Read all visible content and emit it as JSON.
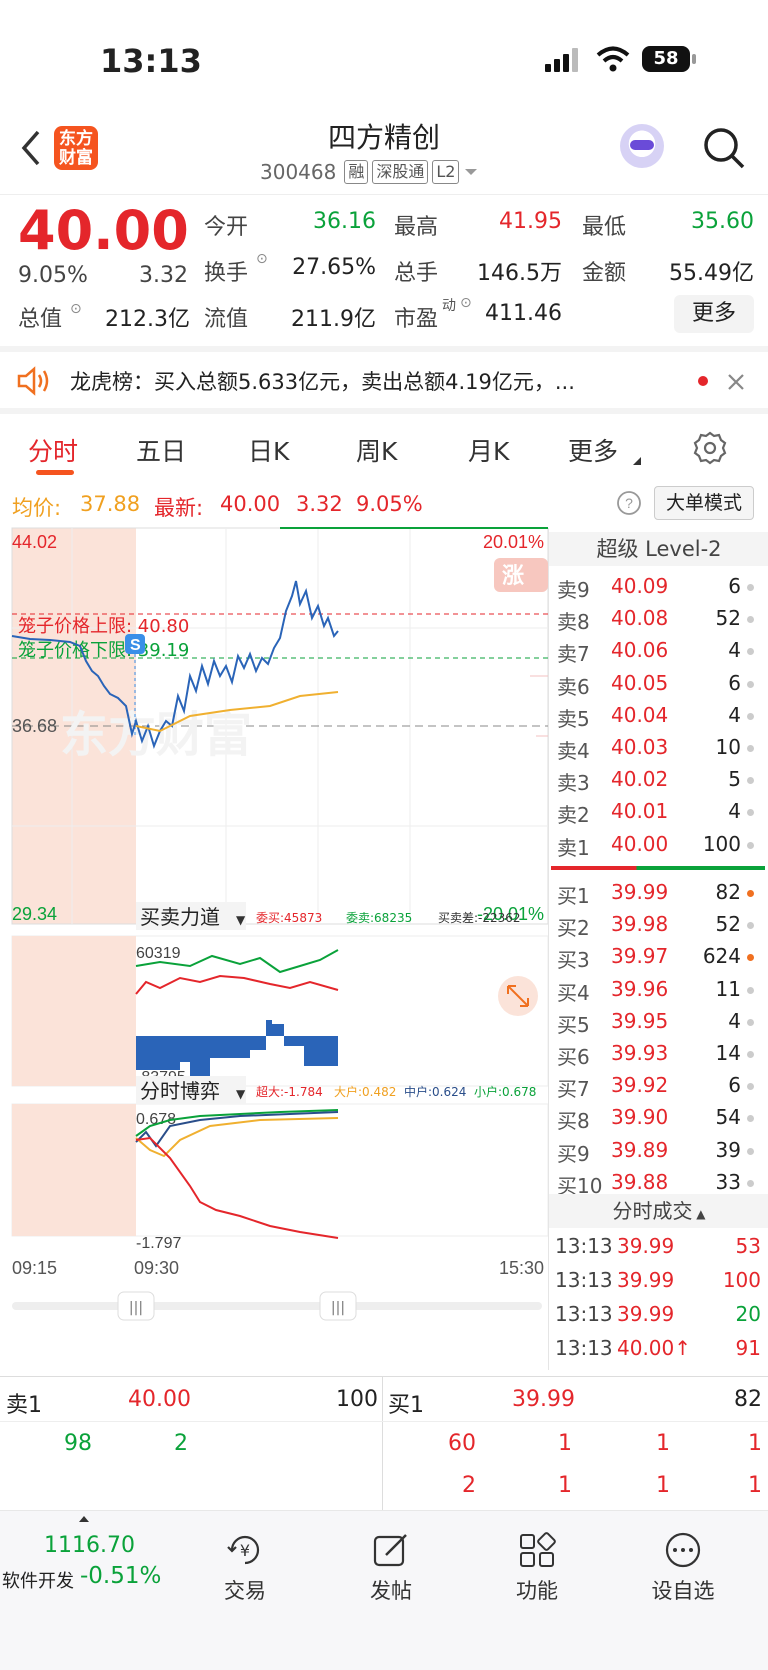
{
  "status_bar": {
    "time": "13:13",
    "battery": "58"
  },
  "header": {
    "logo_line1": "东方",
    "logo_line2": "财富",
    "title": "四方精创",
    "code": "300468",
    "tags": [
      "融",
      "深股通",
      "L2"
    ]
  },
  "quote": {
    "price": "40.00",
    "change_pct": "9.05%",
    "change": "3.32",
    "stats": [
      {
        "label": "今开",
        "value": "36.16",
        "color": "green"
      },
      {
        "label": "最高",
        "value": "41.95",
        "color": "red"
      },
      {
        "label": "最低",
        "value": "35.60",
        "color": "green"
      },
      {
        "label": "换手",
        "value": "27.65%",
        "color": "dark"
      },
      {
        "label": "总手",
        "value": "146.5万",
        "color": "dark"
      },
      {
        "label": "金额",
        "value": "55.49亿",
        "color": "dark"
      },
      {
        "label": "总值",
        "value": "212.3亿",
        "color": "dark"
      },
      {
        "label": "流值",
        "value": "211.9亿",
        "color": "dark"
      },
      {
        "label": "市盈",
        "value": "411.46",
        "color": "dark"
      }
    ],
    "pe_sup": "动",
    "more_label": "更多"
  },
  "banner": {
    "text": "龙虎榜：买入总额5.633亿元，卖出总额4.19亿元，..."
  },
  "tabs": [
    "分时",
    "五日",
    "日K",
    "周K",
    "月K",
    "更多"
  ],
  "info_line": {
    "avg_label": "均价:",
    "avg_value": "37.88",
    "latest_label": "最新:",
    "latest_value": "40.00",
    "latest_change": "3.32",
    "latest_pct": "9.05%",
    "mode_button": "大单模式"
  },
  "chart_data": {
    "type": "line",
    "y_max_label": "44.02",
    "y_min_label": "29.34",
    "y_mid_label": "36.68",
    "pct_max_label": "20.01%",
    "pct_min_label": "-20.01%",
    "cage_upper": "笼子价格上限: 40.80",
    "cage_lower": "笼子价格下限: 39.19",
    "ylim": [
      29.34,
      44.02
    ],
    "time_labels": [
      "09:15",
      "09:30",
      "15:30"
    ],
    "watermark": "东方财富",
    "limit_badge": "涨",
    "s_marker": "S",
    "sub1_title": "买卖力道",
    "sub1_stats": [
      "委买:45873",
      "委卖:68235",
      "买卖差:-22362"
    ],
    "sub1_max": "60319",
    "sub1_min": "-83795",
    "sub2_title": "分时博弈",
    "sub2_stats": [
      "超大:-1.784",
      "大户:0.482",
      "中户:0.624",
      "小户:0.678"
    ],
    "sub2_max": "0.678",
    "sub2_min": "-1.797"
  },
  "order_book": {
    "title": "超级 Level-2",
    "asks": [
      {
        "label": "卖9",
        "price": "40.09",
        "vol": "6"
      },
      {
        "label": "卖8",
        "price": "40.08",
        "vol": "52"
      },
      {
        "label": "卖7",
        "price": "40.06",
        "vol": "4"
      },
      {
        "label": "卖6",
        "price": "40.05",
        "vol": "6"
      },
      {
        "label": "卖5",
        "price": "40.04",
        "vol": "4"
      },
      {
        "label": "卖4",
        "price": "40.03",
        "vol": "10"
      },
      {
        "label": "卖3",
        "price": "40.02",
        "vol": "5"
      },
      {
        "label": "卖2",
        "price": "40.01",
        "vol": "4"
      },
      {
        "label": "卖1",
        "price": "40.00",
        "vol": "100"
      }
    ],
    "bids": [
      {
        "label": "买1",
        "price": "39.99",
        "vol": "82"
      },
      {
        "label": "买2",
        "price": "39.98",
        "vol": "52"
      },
      {
        "label": "买3",
        "price": "39.97",
        "vol": "624"
      },
      {
        "label": "买4",
        "price": "39.96",
        "vol": "11"
      },
      {
        "label": "买5",
        "price": "39.95",
        "vol": "4"
      },
      {
        "label": "买6",
        "price": "39.93",
        "vol": "14"
      },
      {
        "label": "买7",
        "price": "39.92",
        "vol": "6"
      },
      {
        "label": "买8",
        "price": "39.90",
        "vol": "54"
      },
      {
        "label": "买9",
        "price": "39.89",
        "vol": "39"
      },
      {
        "label": "买10",
        "price": "39.88",
        "vol": "33"
      }
    ],
    "trades_title": "分时成交",
    "trades": [
      {
        "time": "13:13",
        "price": "39.99",
        "vol": "53",
        "color": "red"
      },
      {
        "time": "13:13",
        "price": "39.99",
        "vol": "100",
        "color": "red"
      },
      {
        "time": "13:13",
        "price": "39.99",
        "vol": "20",
        "color": "green"
      },
      {
        "time": "13:13",
        "price": "40.00↑",
        "vol": "91",
        "color": "red"
      }
    ]
  },
  "summary": {
    "ask_label": "卖1",
    "ask_price": "40.00",
    "ask_vol": "100",
    "bid_label": "买1",
    "bid_price": "39.99",
    "bid_vol": "82",
    "left_row": [
      "98",
      "2"
    ],
    "right_row1": [
      "60",
      "1",
      "1",
      "1"
    ],
    "right_row2": [
      "2",
      "1",
      "1",
      "1"
    ]
  },
  "nav": {
    "index_value": "1116.70",
    "index_name": "软件开发",
    "index_pct": "-0.51%",
    "items": [
      "交易",
      "发帖",
      "功能",
      "设自选"
    ]
  }
}
